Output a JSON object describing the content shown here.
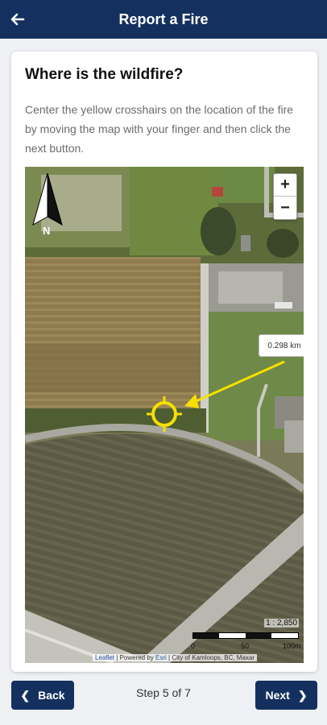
{
  "header": {
    "title": "Report a Fire",
    "back_icon": "arrow-left-icon"
  },
  "card": {
    "heading": "Where is the wildfire?",
    "instructions": "Center the yellow crosshairs on the location of the fire by moving the map with your finger and then click the next button."
  },
  "map": {
    "compass_label": "N",
    "zoom_in": "+",
    "zoom_out": "−",
    "measurement": "0.298 km",
    "scale_ratio": "1 : 2,850",
    "scale_labels": [
      "0",
      "50",
      "100m"
    ],
    "attribution": {
      "leaflet": "Leaflet",
      "sep1": " | Powered by ",
      "esri": "Esri",
      "rest": " | City of Kamloops, BC, Maxar"
    },
    "crosshair_color": "#f5e000"
  },
  "footer": {
    "back_label": "Back",
    "next_label": "Next",
    "step_text": "Step 5 of 7"
  },
  "colors": {
    "primary": "#14305e"
  }
}
